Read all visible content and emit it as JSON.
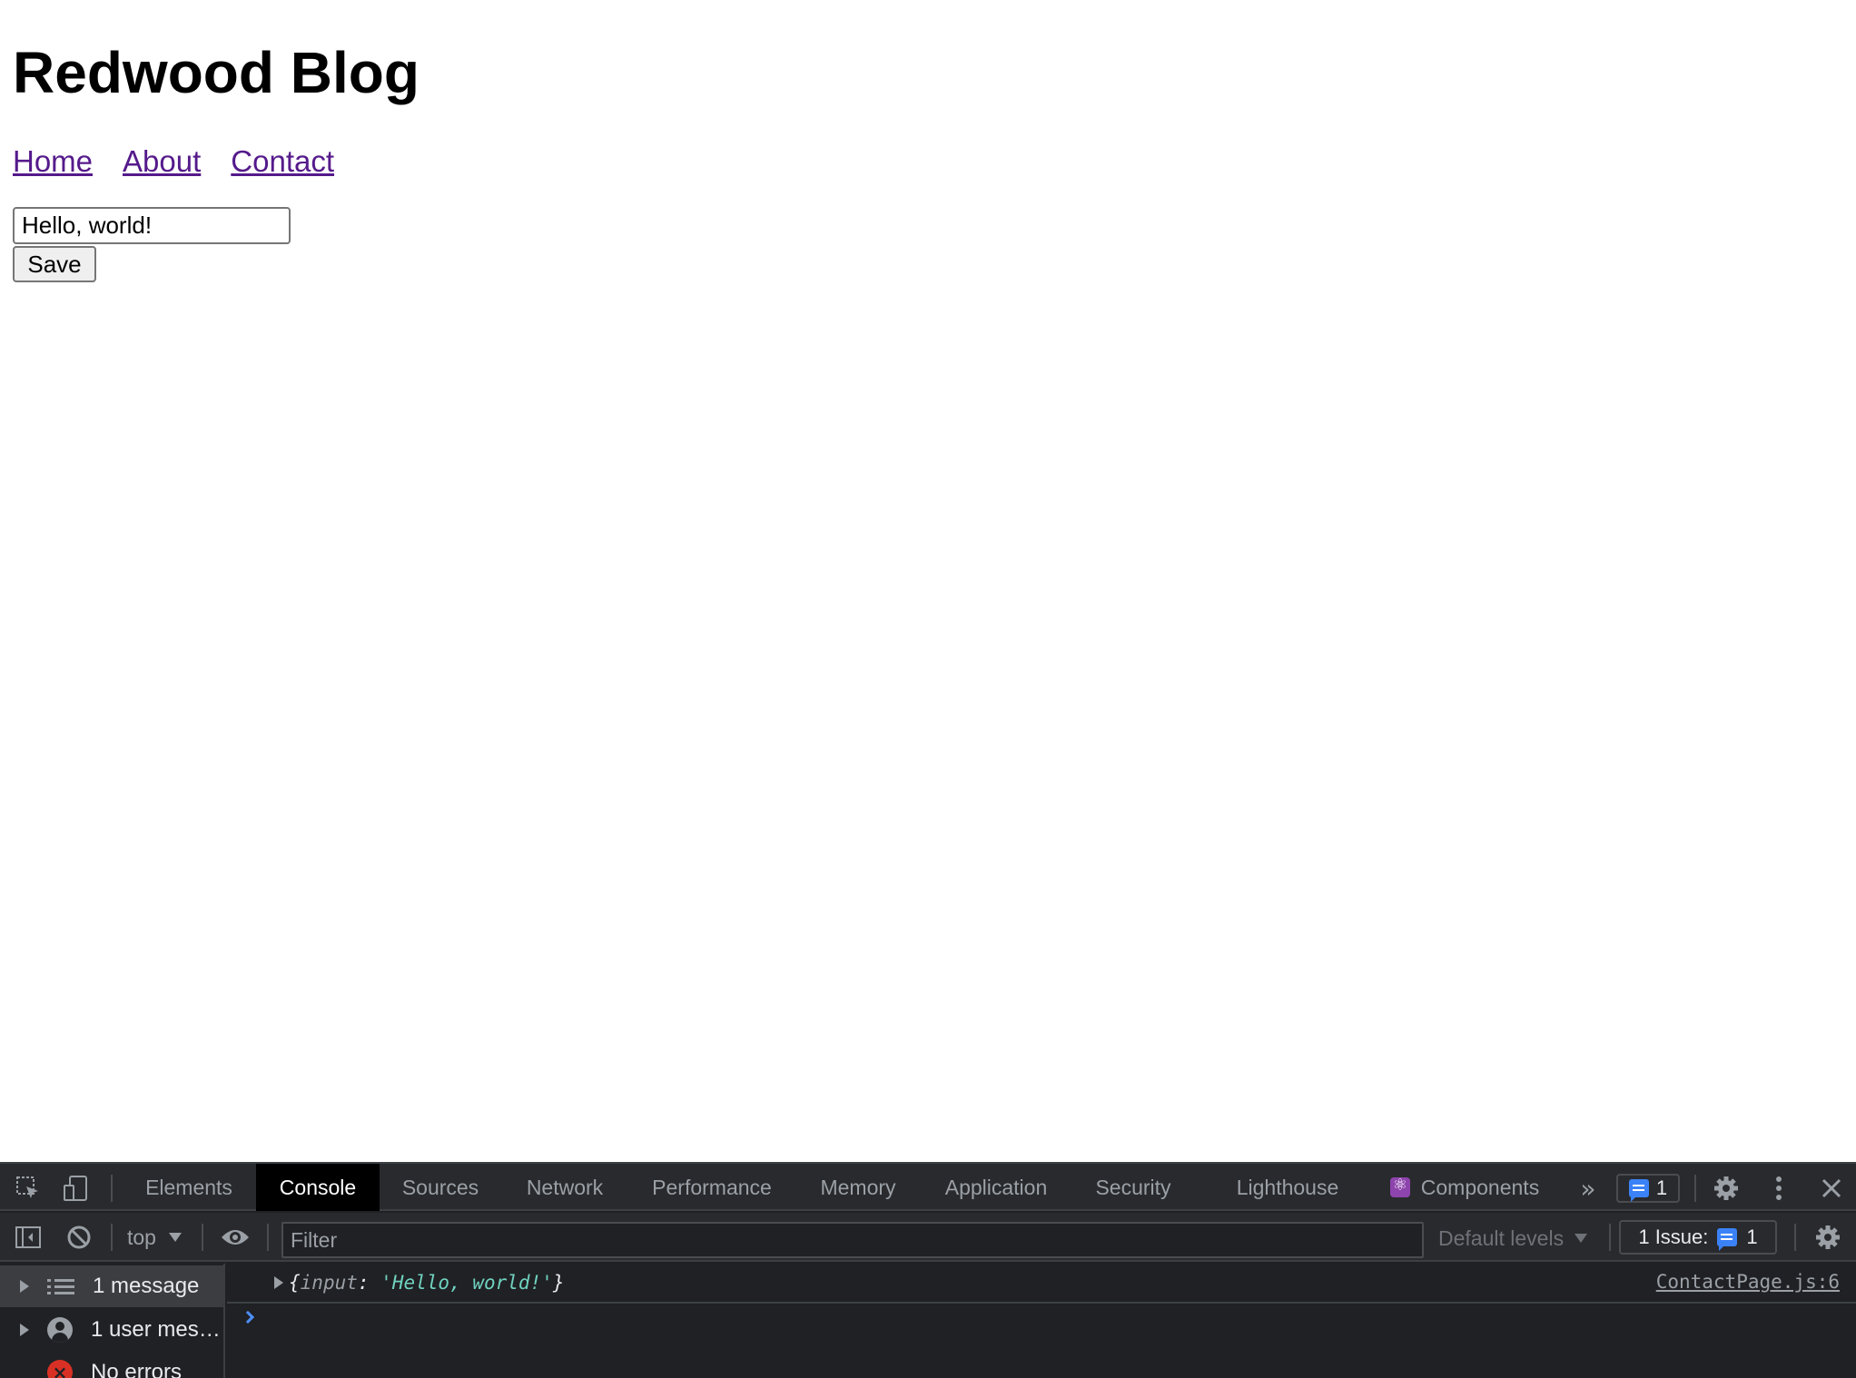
{
  "page": {
    "title": "Redwood Blog",
    "nav": [
      {
        "label": "Home"
      },
      {
        "label": "About"
      },
      {
        "label": "Contact"
      }
    ],
    "form": {
      "input_value": "Hello, world!",
      "save_label": "Save"
    }
  },
  "devtools": {
    "tabs": [
      {
        "label": "Elements"
      },
      {
        "label": "Console"
      },
      {
        "label": "Sources"
      },
      {
        "label": "Network"
      },
      {
        "label": "Performance"
      },
      {
        "label": "Memory"
      },
      {
        "label": "Application"
      },
      {
        "label": "Security"
      },
      {
        "label": "Lighthouse"
      },
      {
        "label": "Components"
      }
    ],
    "active_tab": "Console",
    "issues_count": "1",
    "toolbar": {
      "context": "top",
      "filter_placeholder": "Filter",
      "levels": "Default levels",
      "issue_label": "1 Issue:",
      "issue_count": "1"
    },
    "sidebar": [
      {
        "label": "1 message",
        "icon": "list-icon"
      },
      {
        "label": "1 user mes…",
        "icon": "user-icon"
      },
      {
        "label": "No errors",
        "icon": "error-icon"
      }
    ],
    "log": {
      "open_brace": "{",
      "key": "input",
      "colon": ": ",
      "value": "'Hello, world!'",
      "close_brace": "}",
      "source": "ContactPage.js:6"
    },
    "colors": {
      "panel_bg": "#202124",
      "link_visited": "#551a8b",
      "accent_blue": "#3b82f6",
      "error_red": "#d93025"
    }
  }
}
